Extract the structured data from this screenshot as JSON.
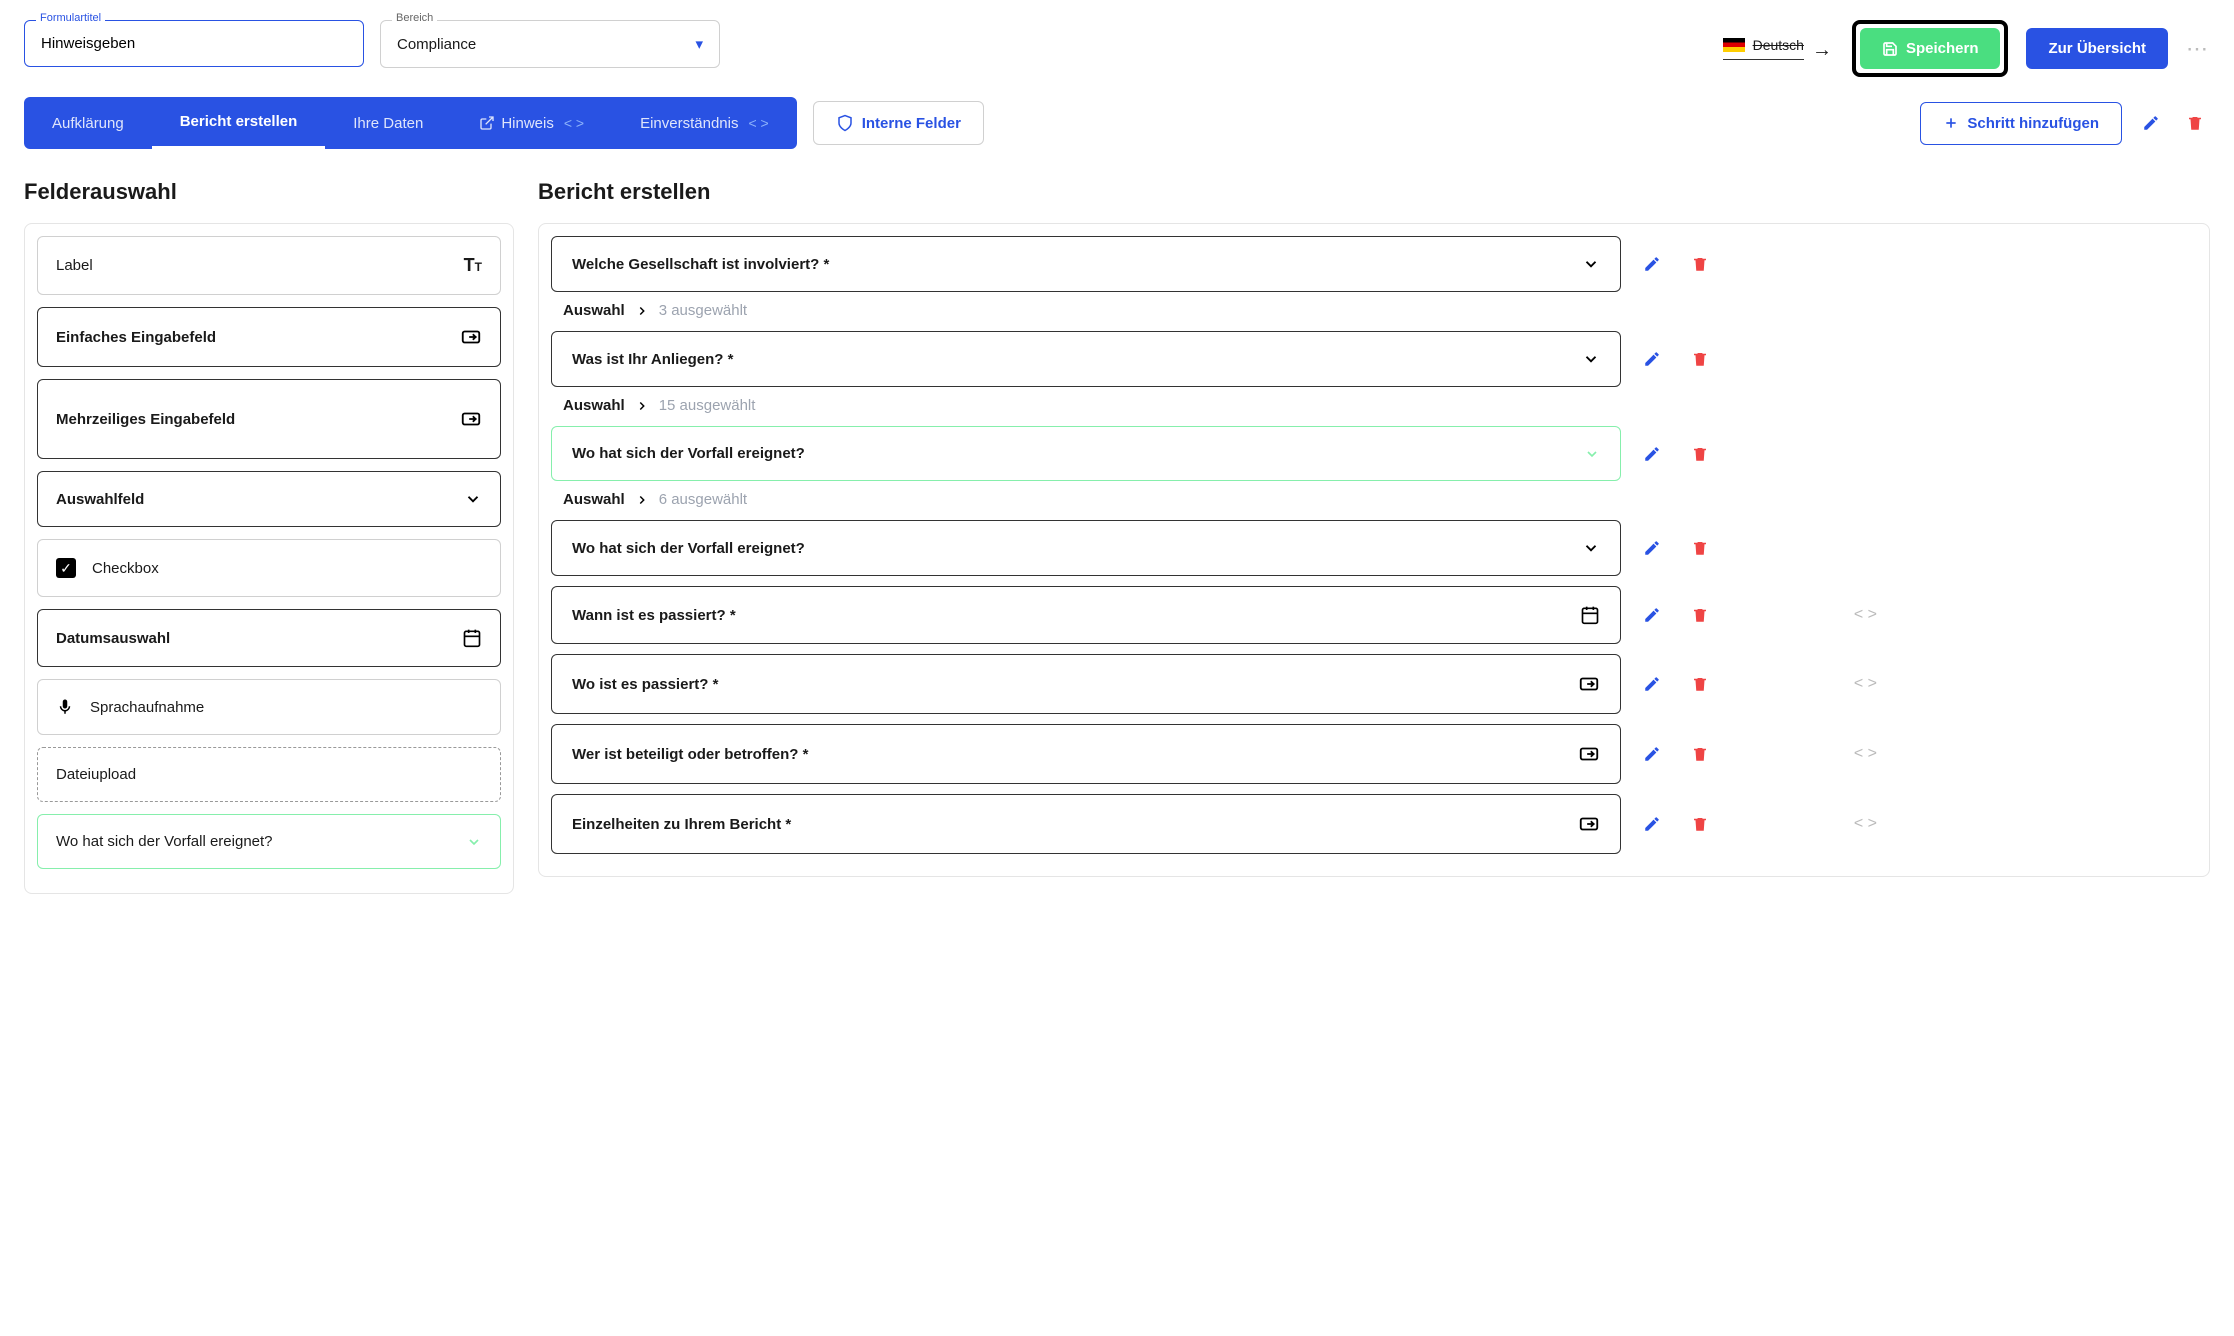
{
  "header": {
    "formTitleLabel": "Formulartitel",
    "formTitleValue": "Hinweisgeben",
    "areaLabel": "Bereich",
    "areaValue": "Compliance",
    "language": "Deutsch",
    "saveLabel": "Speichern",
    "overviewLabel": "Zur Übersicht"
  },
  "tabs": {
    "items": [
      {
        "label": "Aufklärung",
        "active": false
      },
      {
        "label": "Bericht erstellen",
        "active": true
      },
      {
        "label": "Ihre Daten",
        "active": false
      },
      {
        "label": "Hinweis",
        "active": false,
        "external": true,
        "code": true
      },
      {
        "label": "Einverständnis",
        "active": false,
        "code": true
      }
    ],
    "internalFields": "Interne Felder",
    "addStep": "Schritt hinzufügen"
  },
  "leftPanel": {
    "title": "Felderauswahl",
    "items": [
      {
        "label": "Label",
        "type": "text"
      },
      {
        "label": "Einfaches Eingabefeld",
        "type": "input"
      },
      {
        "label": "Mehrzeiliges Eingabefeld",
        "type": "input"
      },
      {
        "label": "Auswahlfeld",
        "type": "select"
      },
      {
        "label": "Checkbox",
        "type": "checkbox"
      },
      {
        "label": "Datumsauswahl",
        "type": "date"
      },
      {
        "label": "Sprachaufnahme",
        "type": "mic"
      },
      {
        "label": "Dateiupload",
        "type": "dashed"
      },
      {
        "label": "Wo hat sich der Vorfall ereignet?",
        "type": "green"
      }
    ]
  },
  "rightPanel": {
    "title": "Bericht erstellen",
    "auswahlLabel": "Auswahl",
    "fields": [
      {
        "label": "Welche Gesellschaft ist involviert? *",
        "icon": "chevron",
        "meta": "3 ausgewählt",
        "code": false
      },
      {
        "label": "Was ist Ihr Anliegen? *",
        "icon": "chevron",
        "meta": "15 ausgewählt",
        "code": false
      },
      {
        "label": "Wo hat sich der Vorfall ereignet?",
        "icon": "chevron-green",
        "green": true,
        "meta": "6 ausgewählt",
        "code": false
      },
      {
        "label": "Wo hat sich der Vorfall ereignet?",
        "icon": "chevron",
        "code": false
      },
      {
        "label": "Wann ist es passiert? *",
        "icon": "date",
        "code": true
      },
      {
        "label": "Wo ist es passiert? *",
        "icon": "input",
        "code": true
      },
      {
        "label": "Wer ist beteiligt oder betroffen? *",
        "icon": "input",
        "code": true
      },
      {
        "label": "Einzelheiten zu Ihrem Bericht *",
        "icon": "input",
        "code": true
      }
    ]
  }
}
